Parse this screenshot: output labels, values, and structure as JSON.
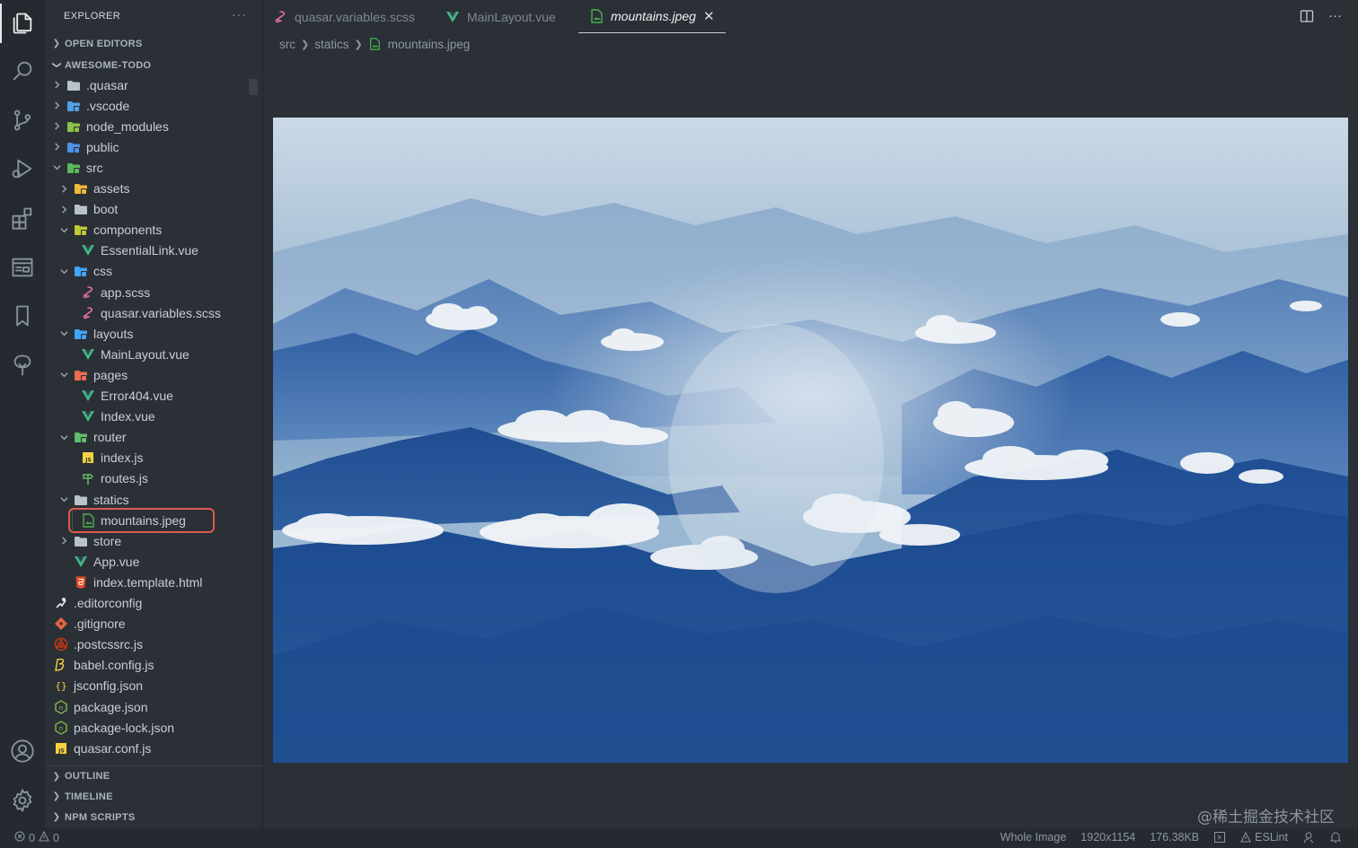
{
  "activity_bar": {
    "icons": [
      "explorer-icon",
      "search-icon",
      "source-control-icon",
      "run-debug-icon",
      "extensions-icon",
      "preview-icon",
      "bookmark-icon",
      "tree-icon",
      "account-icon",
      "settings-gear-icon"
    ]
  },
  "sidebar": {
    "title": "EXPLORER",
    "more": "···",
    "open_editors": "OPEN EDITORS",
    "project": "AWESOME-TODO",
    "outline": "OUTLINE",
    "timeline": "TIMELINE",
    "npm_scripts": "NPM SCRIPTS"
  },
  "tree": [
    {
      "label": ".quasar",
      "type": "folder",
      "icon": "folder-icon",
      "color": "#b8c2cc"
    },
    {
      "label": ".vscode",
      "type": "folder",
      "icon": "folder-vscode-icon",
      "color": "#4fa0e6"
    },
    {
      "label": "node_modules",
      "type": "folder",
      "icon": "folder-node-icon",
      "color": "#8bc34a"
    },
    {
      "label": "public",
      "type": "folder",
      "icon": "folder-public-icon",
      "color": "#4f8fe6"
    },
    {
      "label": "src",
      "type": "folder-open",
      "icon": "folder-src-icon",
      "color": "#5cb85c"
    },
    {
      "label": "assets",
      "type": "folder",
      "icon": "folder-assets-icon",
      "color": "#f0b93a"
    },
    {
      "label": "boot",
      "type": "folder",
      "icon": "folder-icon",
      "color": "#b8c2cc"
    },
    {
      "label": "components",
      "type": "folder-open",
      "icon": "folder-components-icon",
      "color": "#c0ca33"
    },
    {
      "label": "EssentialLink.vue",
      "type": "file",
      "icon": "vue-icon",
      "color": "#41b883"
    },
    {
      "label": "css",
      "type": "folder-open",
      "icon": "folder-css-icon",
      "color": "#42a5f5"
    },
    {
      "label": "app.scss",
      "type": "file",
      "icon": "sass-icon",
      "color": "#ec6ea1"
    },
    {
      "label": "quasar.variables.scss",
      "type": "file",
      "icon": "sass-icon",
      "color": "#ec6ea1"
    },
    {
      "label": "layouts",
      "type": "folder-open",
      "icon": "folder-layouts-icon",
      "color": "#42a5f5"
    },
    {
      "label": "MainLayout.vue",
      "type": "file",
      "icon": "vue-icon",
      "color": "#41b883"
    },
    {
      "label": "pages",
      "type": "folder-open",
      "icon": "folder-pages-icon",
      "color": "#ef6c4f"
    },
    {
      "label": "Error404.vue",
      "type": "file",
      "icon": "vue-icon",
      "color": "#41b883"
    },
    {
      "label": "Index.vue",
      "type": "file",
      "icon": "vue-icon",
      "color": "#41b883"
    },
    {
      "label": "router",
      "type": "folder-open",
      "icon": "folder-router-icon",
      "color": "#66bb6a"
    },
    {
      "label": "index.js",
      "type": "file",
      "icon": "js-icon",
      "color": "#f5d33e"
    },
    {
      "label": "routes.js",
      "type": "file",
      "icon": "routes-icon",
      "color": "#66bb6a"
    },
    {
      "label": "statics",
      "type": "folder-open",
      "icon": "folder-icon",
      "color": "#b8c2cc"
    },
    {
      "label": "mountains.jpeg",
      "type": "file",
      "icon": "image-icon",
      "color": "#4caf50",
      "selected": true
    },
    {
      "label": "store",
      "type": "folder",
      "icon": "folder-icon",
      "color": "#b8c2cc"
    },
    {
      "label": "App.vue",
      "type": "file",
      "icon": "vue-icon",
      "color": "#41b883"
    },
    {
      "label": "index.template.html",
      "type": "file",
      "icon": "html-icon",
      "color": "#e44d26"
    },
    {
      "label": ".editorconfig",
      "type": "file",
      "icon": "editorconfig-icon",
      "color": "#e6e9ec"
    },
    {
      "label": ".gitignore",
      "type": "file",
      "icon": "git-icon",
      "color": "#e4643f"
    },
    {
      "label": ".postcssrc.js",
      "type": "file",
      "icon": "postcss-icon",
      "color": "#dd3a0a"
    },
    {
      "label": "babel.config.js",
      "type": "file",
      "icon": "babel-icon",
      "color": "#f5d33e"
    },
    {
      "label": "jsconfig.json",
      "type": "file",
      "icon": "json-icon",
      "color": "#f5d33e"
    },
    {
      "label": "package.json",
      "type": "file",
      "icon": "npm-icon",
      "color": "#8bc34a"
    },
    {
      "label": "package-lock.json",
      "type": "file",
      "icon": "npm-icon",
      "color": "#8bc34a"
    },
    {
      "label": "quasar.conf.js",
      "type": "file",
      "icon": "js-icon",
      "color": "#f5d33e"
    }
  ],
  "tabs": [
    {
      "label": "quasar.variables.scss",
      "icon": "sass-icon",
      "color": "#ec6ea1"
    },
    {
      "label": "MainLayout.vue",
      "icon": "vue-icon",
      "color": "#41b883"
    },
    {
      "label": "mountains.jpeg",
      "icon": "image-icon",
      "color": "#4caf50",
      "active": true,
      "close": "✕"
    }
  ],
  "breadcrumb": [
    "src",
    "statics",
    "mountains.jpeg"
  ],
  "watermark": "@稀土掘金技术社区",
  "status": {
    "errors": "0",
    "warnings": "0",
    "zoom": "Whole Image",
    "dimensions": "1920x1154",
    "size": "176.38KB",
    "eslint": "ESLint"
  },
  "colors": {
    "accent_selected_outline": "#e05a4e",
    "background": "#2b3036",
    "activity_bar": "#252a30"
  }
}
